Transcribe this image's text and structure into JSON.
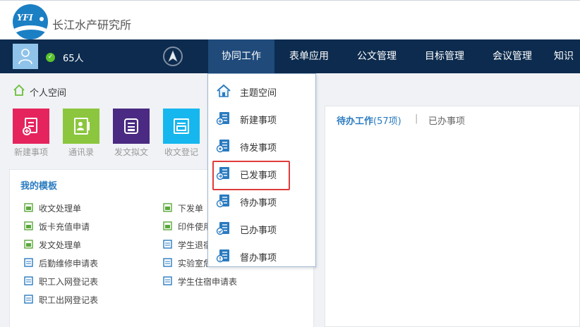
{
  "header": {
    "org_name": "长江水产研究所",
    "logo_text": "YFI"
  },
  "user": {
    "online_count": "65人"
  },
  "nav": {
    "items": [
      "协同工作",
      "表单应用",
      "公文管理",
      "目标管理",
      "会议管理",
      "知识"
    ]
  },
  "dropdown": {
    "items": [
      "主题空间",
      "新建事项",
      "待发事项",
      "已发事项",
      "待办事项",
      "已办事项",
      "督办事项"
    ]
  },
  "personal_space": {
    "title": "个人空间",
    "tiles": [
      "新建事项",
      "通讯录",
      "发文拟文",
      "收文登记"
    ]
  },
  "templates": {
    "title": "我的模板",
    "col1": [
      "收文处理单",
      "饭卡充值申请",
      "发文处理单",
      "后勤维修申请表",
      "职工入网登记表",
      "职工出网登记表"
    ],
    "col2": [
      "下发单",
      "印件使用",
      "学生退宿",
      "实验室危",
      "学生住宿申请表"
    ]
  },
  "work": {
    "pending_label": "待办工作",
    "pending_count": "(57项)",
    "separator": "|",
    "done_label": "已办事项"
  },
  "colors": {
    "nav_bg": "#0c2b4e",
    "accent": "#2a7bc0",
    "highlight_border": "#e03b3b"
  },
  "icons": {
    "logo": "yfi-logo-icon",
    "avatar": "user-avatar-icon",
    "status": "online-check-icon",
    "compass": "navigation-arrow-icon",
    "home": "home-icon",
    "theme_space": "theme-space-icon",
    "list": "list-document-icon",
    "tiles": [
      "new-item-icon",
      "address-book-icon",
      "draft-document-icon",
      "receive-document-icon"
    ]
  }
}
